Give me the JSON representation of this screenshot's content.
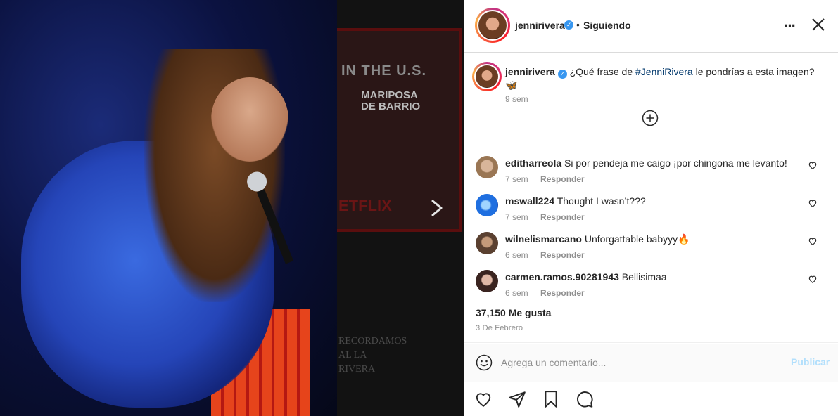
{
  "post": {
    "username": "jennirivera",
    "follow_status": "Siguiendo",
    "caption_text": "¿Qué frase de ",
    "caption_hashtag": "#JenniRivera",
    "caption_suffix": " le pondrías a esta imagen?",
    "caption_emoji": "🦋",
    "caption_time": "9 sem",
    "likes": "37,150 Me gusta",
    "date": "3 De Febrero"
  },
  "comments": [
    {
      "user": "editharreola",
      "text": "Si por pendeja me caigo ¡por chingona me levanto!",
      "time": "7 sem",
      "reply": "Responder"
    },
    {
      "user": "mswall224",
      "text": "Thought I wasn’t???",
      "time": "7 sem",
      "reply": "Responder"
    },
    {
      "user": "wilnelismarcano",
      "text": "Unforgattable babyyy🔥",
      "time": "6 sem",
      "reply": "Responder"
    },
    {
      "user": "carmen.ramos.90281943",
      "text": "Bellisimaa",
      "time": "6 sem",
      "reply": "Responder"
    }
  ],
  "comment_box": {
    "placeholder": "Agrega un comentario...",
    "publish_label": "Publicar"
  },
  "preview": {
    "poster_text": "IN THE U.S.",
    "poster_title_1": "MARIPOSA",
    "poster_title_2": "DE BARRIO",
    "poster_brand": "ETFLIX",
    "lower_line_1": "RECORDAMOS",
    "lower_line_2": "AL LA",
    "lower_line_3": "RIVERA"
  },
  "colors": {
    "link_blue": "#00376b",
    "verified_blue": "#3897f0",
    "publish_disabled": "#b2dffc",
    "muted": "#8e8e8e"
  },
  "icons": [
    "more-icon",
    "close-icon",
    "plus-circle-icon",
    "heart-icon",
    "share-icon",
    "bookmark-icon",
    "comment-icon",
    "emoji-icon",
    "chevron-right-icon",
    "verified-icon"
  ]
}
